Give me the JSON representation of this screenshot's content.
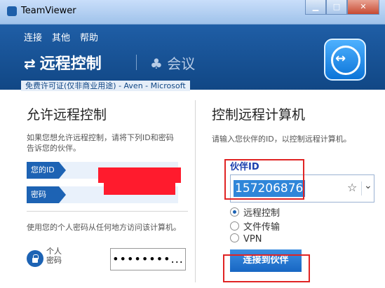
{
  "window": {
    "title": "TeamViewer",
    "controls": [
      "minimize",
      "maximize",
      "close"
    ]
  },
  "menu": [
    "连接",
    "其他",
    "帮助"
  ],
  "tabs": {
    "remote": "远程控制",
    "meeting": "会议"
  },
  "license": "免费许可证(仅非商业用途) - Aven - Microsoft",
  "left": {
    "title": "允许远程控制",
    "desc": "如果您想允许远程控制，请将下列ID和密码告诉您的伙伴。",
    "id_label": "您的ID",
    "pw_label": "密码",
    "personal_desc": "使用您的个人密码从任何地方访问该计算机。",
    "personal_label": "个人\n密码",
    "personal_value": "••••••••..."
  },
  "right": {
    "title": "控制远程计算机",
    "desc": "请输入您伙伴的ID，以控制远程计算机。",
    "partner_label": "伙伴ID",
    "partner_value": "157206876",
    "options": [
      "远程控制",
      "文件传输",
      "VPN"
    ],
    "selected_option": "远程控制",
    "connect_label": "连接到伙伴"
  },
  "colors": {
    "accent": "#1d63b4",
    "highlight": "#e02424"
  },
  "icons": {
    "app": "teamviewer-logo-icon",
    "star": "star-icon",
    "dropdown": "chevron-down-icon",
    "lock": "lock-icon"
  }
}
